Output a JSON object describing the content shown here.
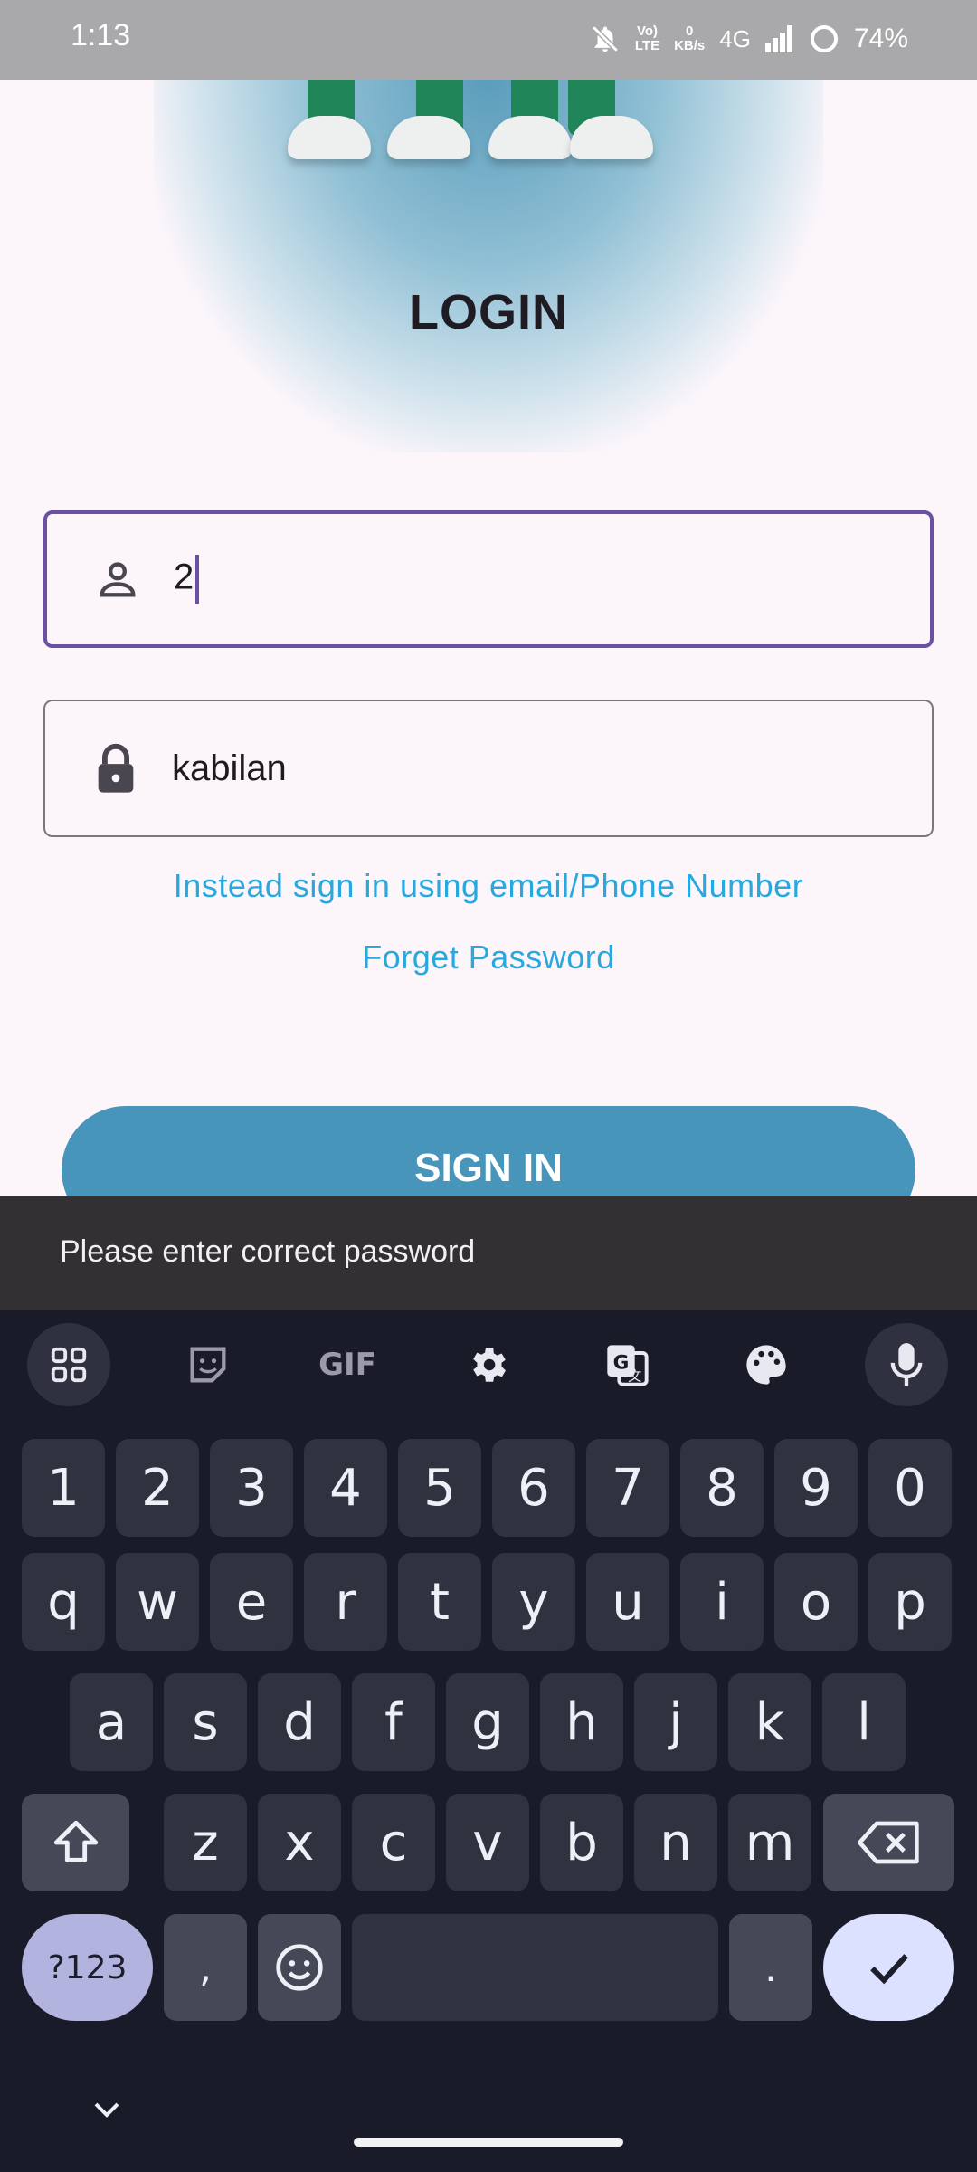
{
  "status_bar": {
    "time": "1:13",
    "volte_top": "Vo)",
    "volte_bottom": "LTE",
    "speed_value": "0",
    "speed_unit": "KB/s",
    "network": "4G",
    "battery": "74%",
    "icons": [
      "bell-off-icon",
      "volte-icon",
      "signal-icon",
      "battery-ring-icon"
    ]
  },
  "login": {
    "title": "LOGIN",
    "username_value": "2",
    "password_value": "kabilan",
    "alt_signin_link": "Instead sign in using email/Phone Number",
    "forgot_link": "Forget Password",
    "signin_button": "SIGN IN"
  },
  "snackbar": {
    "message": "Please enter correct password"
  },
  "keyboard": {
    "toolbar_icons": [
      "apps-grid-icon",
      "sticker-icon",
      "gif-icon",
      "gear-icon",
      "translate-icon",
      "palette-icon",
      "microphone-icon"
    ],
    "gif_label": "GIF",
    "row_numbers": [
      "1",
      "2",
      "3",
      "4",
      "5",
      "6",
      "7",
      "8",
      "9",
      "0"
    ],
    "row_q": [
      "q",
      "w",
      "e",
      "r",
      "t",
      "y",
      "u",
      "i",
      "o",
      "p"
    ],
    "row_a": [
      "a",
      "s",
      "d",
      "f",
      "g",
      "h",
      "j",
      "k",
      "l"
    ],
    "row_z": [
      "z",
      "x",
      "c",
      "v",
      "b",
      "n",
      "m"
    ],
    "symbols_key": "?123",
    "comma_key": ",",
    "period_key": "."
  },
  "colors": {
    "accent_purple": "#6a4fa3",
    "link_blue": "#29a8de",
    "button_blue": "#4795ba",
    "keyboard_bg": "#191b28"
  }
}
